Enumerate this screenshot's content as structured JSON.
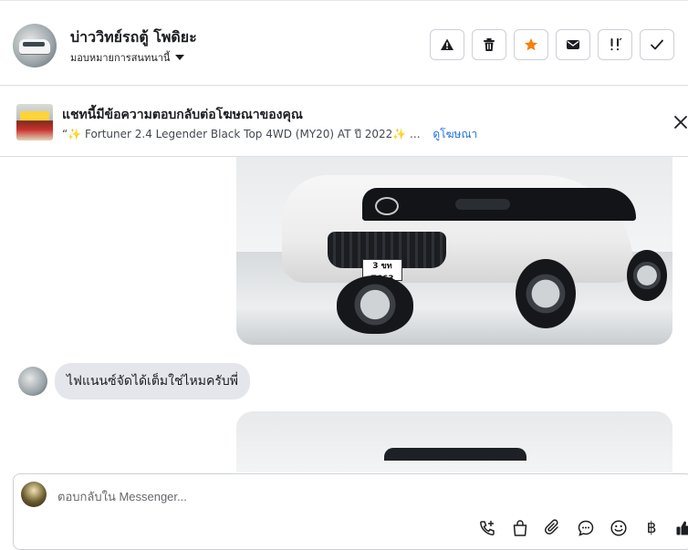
{
  "header": {
    "contact_name": "บ่าววิทย์รถตู้ โพดิยะ",
    "assign_label": "มอบหมายการสนทนานี้",
    "actions": [
      {
        "name": "report-spam-button",
        "icon": "warning-icon"
      },
      {
        "name": "delete-button",
        "icon": "trash-icon"
      },
      {
        "name": "star-button",
        "icon": "star-icon",
        "color": "#f5800b"
      },
      {
        "name": "mark-unread-button",
        "icon": "envelope-icon"
      },
      {
        "name": "follow-up-button",
        "icon": "follow-up-icon"
      },
      {
        "name": "mark-done-button",
        "icon": "check-icon"
      }
    ]
  },
  "ad_banner": {
    "title": "แชทนี้มีข้อความตอบกลับต่อโฆษณาของคุณ",
    "ad_text": "“✨ Fortuner 2.4 Legender Black Top 4WD (MY20) AT ปี 2022✨ ...",
    "view_ad_label": "ดูโฆษณา",
    "link_color": "#216fdb"
  },
  "thread": {
    "photo_plate": "3 ขท 7663",
    "incoming_message": "ไฟแนนซ์จัดได้เต็มใช่ไหมครับพี่"
  },
  "composer": {
    "placeholder": "ตอบกลับใน Messenger...",
    "tools": [
      "add-call-icon",
      "bag-icon",
      "paperclip-icon",
      "chat-bubble-icon",
      "emoji-icon",
      "baht-icon",
      "thumbs-up-icon"
    ],
    "baht_symbol": "฿"
  }
}
